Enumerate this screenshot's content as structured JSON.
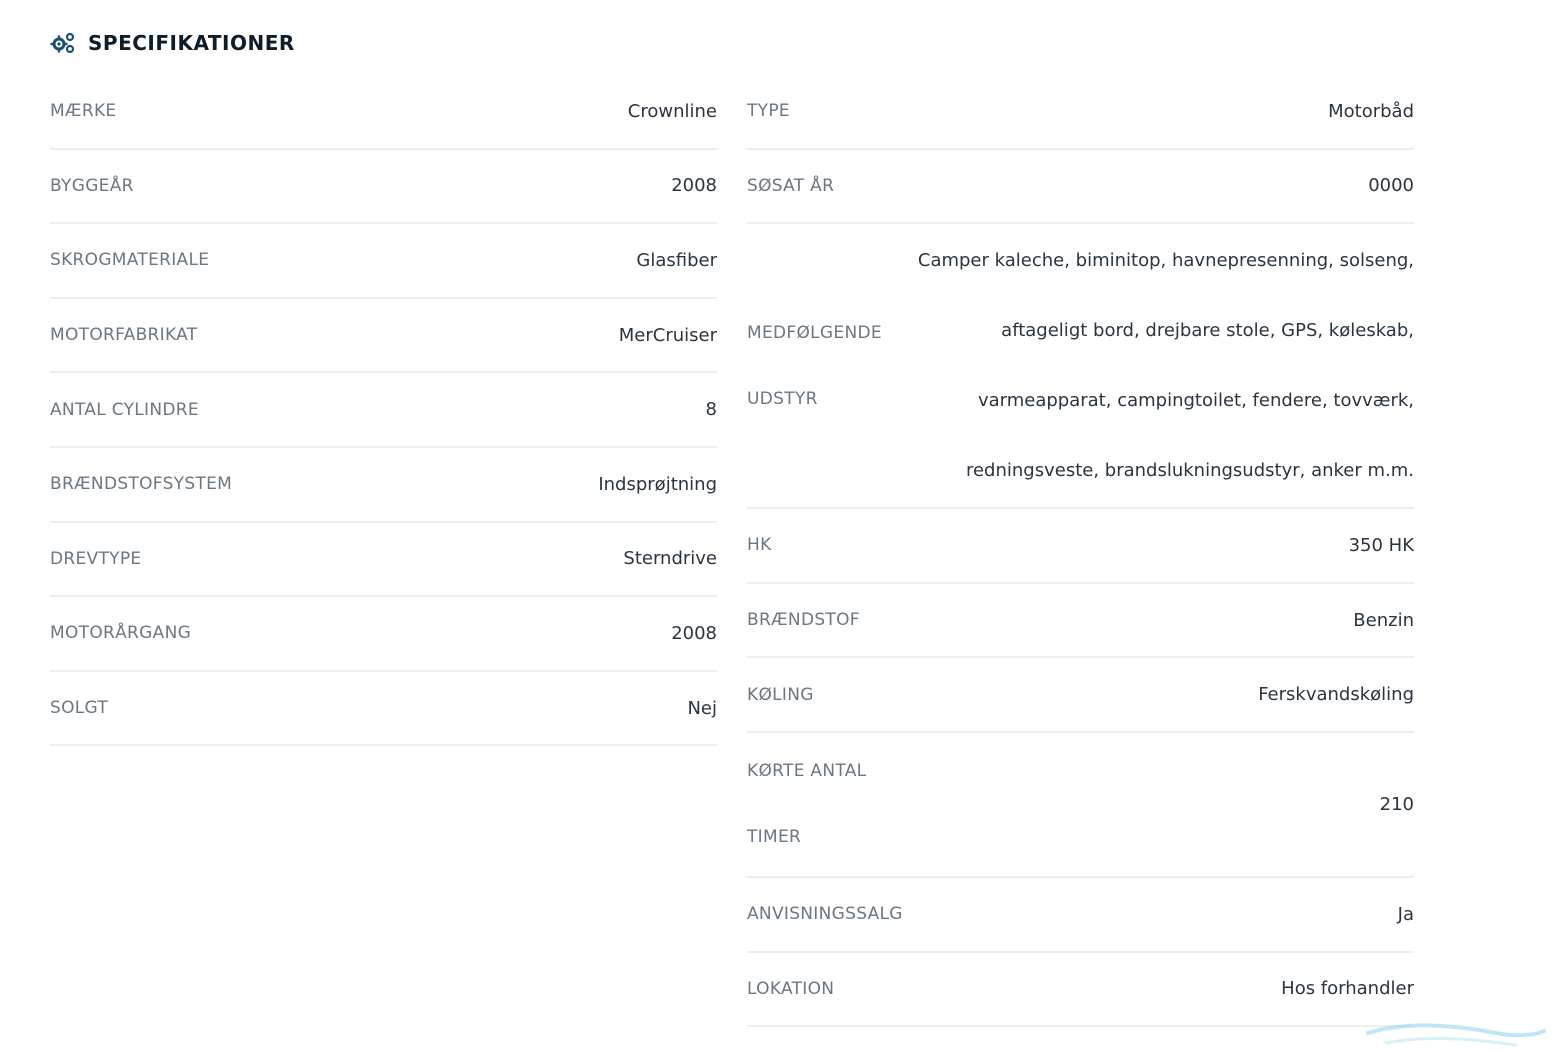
{
  "header": {
    "icon": "gears-icon",
    "title": "SPECIFIKATIONER"
  },
  "left_specs": [
    {
      "label": "MÆRKE",
      "value": "Crownline"
    },
    {
      "label": "BYGGEÅR",
      "value": "2008"
    },
    {
      "label": "SKROGMATERIALE",
      "value": "Glasfiber"
    },
    {
      "label": "MOTORFABRIKAT",
      "value": "MerCruiser"
    },
    {
      "label": "ANTAL CYLINDRE",
      "value": "8"
    },
    {
      "label": "BRÆNDSTOFSYSTEM",
      "value": "Indsprøjtning"
    },
    {
      "label": "DREVTYPE",
      "value": "Sterndrive"
    },
    {
      "label": "MOTORÅRGANG",
      "value": "2008"
    },
    {
      "label": "SOLGT",
      "value": "Nej"
    }
  ],
  "right_specs": {
    "type": {
      "label": "TYPE",
      "value": "Motorbåd"
    },
    "launch_year": {
      "label": "SØSAT ÅR",
      "value": "0000"
    },
    "equipment": {
      "label_line1": "MEDFØLGENDE",
      "label_line2": "UDSTYR",
      "value_lines": [
        "Camper kaleche, biminitop, havnepresenning, solseng,",
        "aftageligt bord, drejbare stole, GPS, køleskab,",
        "varmeapparat, campingtoilet, fendere, tovværk,",
        "redningsveste, brandslukningsudstyr, anker m.m."
      ]
    },
    "hp": {
      "label": "HK",
      "value": "350 HK"
    },
    "fuel": {
      "label": "BRÆNDSTOF",
      "value": "Benzin"
    },
    "cooling": {
      "label": "KØLING",
      "value": "Ferskvandskøling"
    },
    "hours": {
      "label_line1": "KØRTE ANTAL",
      "label_line2": "TIMER",
      "value": "210"
    },
    "referral_sale": {
      "label": "ANVISNINGSSALG",
      "value": "Ja"
    },
    "location": {
      "label": "LOKATION",
      "value": "Hos forhandler"
    }
  },
  "colors": {
    "label": "#6b7782",
    "value": "#2a3540",
    "divider": "#eceff2",
    "title": "#0f1d2a",
    "icon": "#1b4f72"
  }
}
